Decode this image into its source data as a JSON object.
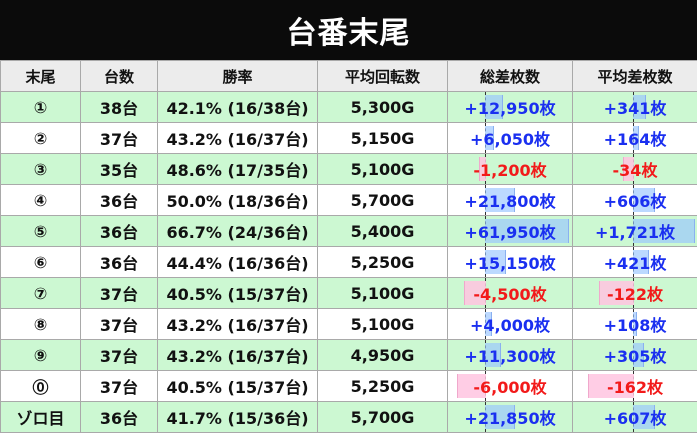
{
  "title": "台番末尾",
  "headers": [
    "末尾",
    "台数",
    "勝率",
    "平均回転数",
    "総差枚数",
    "平均差枚数"
  ],
  "colors": {
    "positive": "#1a2ff0",
    "negative": "#f21a1a",
    "row_highlight": "#ccf8d2"
  },
  "rows": [
    {
      "tail": "①",
      "count": "38台",
      "win_rate": "42.1% (16/38台)",
      "avg_spins": "5,300G",
      "total_diff": "+12,950枚",
      "avg_diff": "+341枚",
      "total_value": 12950,
      "avg_value": 341
    },
    {
      "tail": "②",
      "count": "37台",
      "win_rate": "43.2% (16/37台)",
      "avg_spins": "5,150G",
      "total_diff": "+6,050枚",
      "avg_diff": "+164枚",
      "total_value": 6050,
      "avg_value": 164
    },
    {
      "tail": "③",
      "count": "35台",
      "win_rate": "48.6% (17/35台)",
      "avg_spins": "5,100G",
      "total_diff": "-1,200枚",
      "avg_diff": "-34枚",
      "total_value": -1200,
      "avg_value": -34
    },
    {
      "tail": "④",
      "count": "36台",
      "win_rate": "50.0% (18/36台)",
      "avg_spins": "5,700G",
      "total_diff": "+21,800枚",
      "avg_diff": "+606枚",
      "total_value": 21800,
      "avg_value": 606
    },
    {
      "tail": "⑤",
      "count": "36台",
      "win_rate": "66.7% (24/36台)",
      "avg_spins": "5,400G",
      "total_diff": "+61,950枚",
      "avg_diff": "+1,721枚",
      "total_value": 61950,
      "avg_value": 1721
    },
    {
      "tail": "⑥",
      "count": "36台",
      "win_rate": "44.4% (16/36台)",
      "avg_spins": "5,250G",
      "total_diff": "+15,150枚",
      "avg_diff": "+421枚",
      "total_value": 15150,
      "avg_value": 421
    },
    {
      "tail": "⑦",
      "count": "37台",
      "win_rate": "40.5% (15/37台)",
      "avg_spins": "5,100G",
      "total_diff": "-4,500枚",
      "avg_diff": "-122枚",
      "total_value": -4500,
      "avg_value": -122
    },
    {
      "tail": "⑧",
      "count": "37台",
      "win_rate": "43.2% (16/37台)",
      "avg_spins": "5,100G",
      "total_diff": "+4,000枚",
      "avg_diff": "+108枚",
      "total_value": 4000,
      "avg_value": 108
    },
    {
      "tail": "⑨",
      "count": "37台",
      "win_rate": "43.2% (16/37台)",
      "avg_spins": "4,950G",
      "total_diff": "+11,300枚",
      "avg_diff": "+305枚",
      "total_value": 11300,
      "avg_value": 305
    },
    {
      "tail": "⓪",
      "count": "37台",
      "win_rate": "40.5% (15/37台)",
      "avg_spins": "5,250G",
      "total_diff": "-6,000枚",
      "avg_diff": "-162枚",
      "total_value": -6000,
      "avg_value": -162
    },
    {
      "tail": "ゾロ目",
      "count": "36台",
      "win_rate": "41.7% (15/36台)",
      "avg_spins": "5,700G",
      "total_diff": "+21,850枚",
      "avg_diff": "+607枚",
      "total_value": 21850,
      "avg_value": 607
    }
  ]
}
